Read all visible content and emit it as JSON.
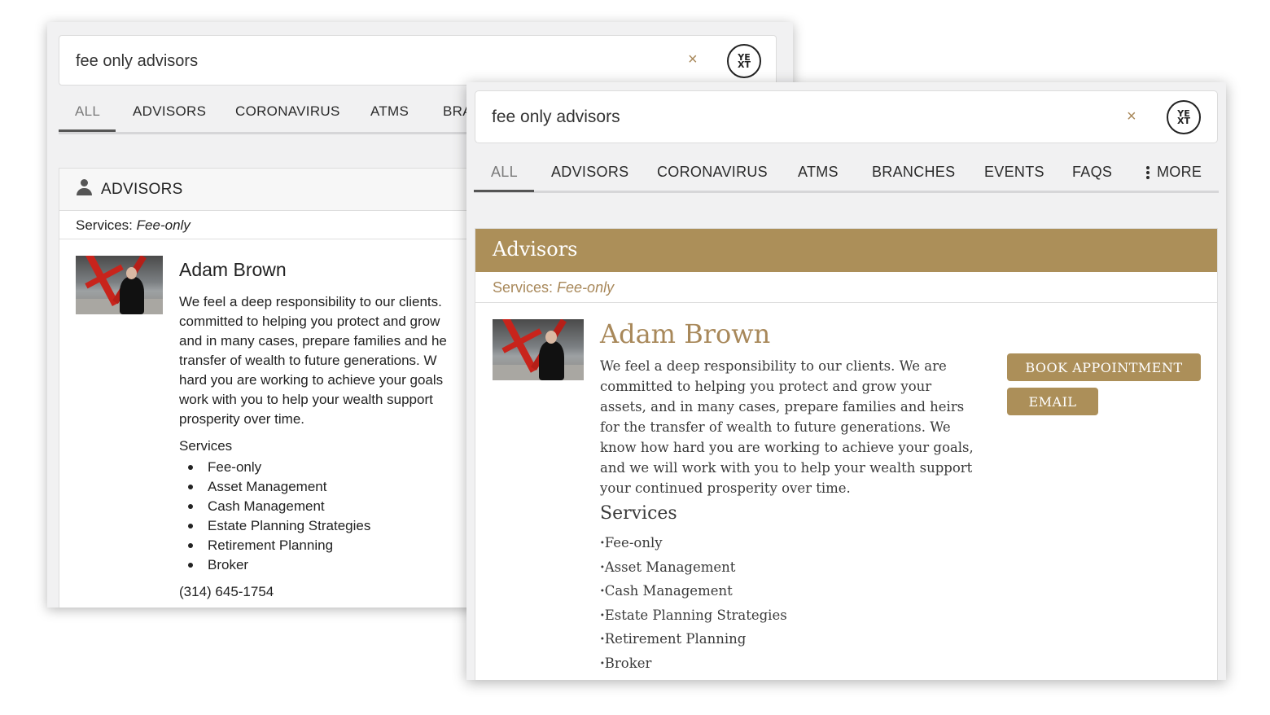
{
  "logo_text": [
    "YE",
    "XT"
  ],
  "back_card": {
    "search": {
      "query": "fee only advisors",
      "clear": "×"
    },
    "tabs": [
      "ALL",
      "ADVISORS",
      "CORONAVIRUS",
      "ATMS",
      "BRA"
    ],
    "section": {
      "title": "ADVISORS",
      "filter_label": "Services:",
      "filter_value": "Fee-only"
    },
    "result": {
      "name": "Adam Brown",
      "desc_lines": [
        "We feel a deep responsibility to our clients.",
        "committed to helping you protect and grow",
        "and in many cases, prepare families and he",
        "transfer of wealth to future generations. W",
        "hard you are working to achieve your goals",
        "work with you to help your wealth support",
        "prosperity over time."
      ],
      "services_title": "Services",
      "services": [
        "Fee-only",
        "Asset Management",
        "Cash Management",
        "Estate Planning Strategies",
        "Retirement Planning",
        "Broker"
      ],
      "phone": "(314) 645-1754"
    }
  },
  "front_card": {
    "search": {
      "query": "fee only advisors",
      "clear": "×"
    },
    "tabs": [
      "ALL",
      "ADVISORS",
      "CORONAVIRUS",
      "ATMS",
      "BRANCHES",
      "EVENTS",
      "FAQS",
      "MORE"
    ],
    "section": {
      "title": "Advisors",
      "filter_label": "Services:",
      "filter_value": "Fee-only"
    },
    "result": {
      "name": "Adam Brown",
      "desc_lines": [
        "We feel a deep responsibility to our clients. We are",
        "committed to helping you protect and grow your",
        "assets, and in many cases, prepare families and heirs",
        "for the transfer of wealth to future generations. We",
        "know how hard you are working to achieve your goals,",
        "and we will work with you to help your wealth support",
        "your continued prosperity over time."
      ],
      "services_title": "Services",
      "services": [
        "Fee-only",
        "Asset Management",
        "Cash Management",
        "Estate Planning Strategies",
        "Retirement Planning",
        "Broker"
      ],
      "book_label": "BOOK APPOINTMENT",
      "email_label": "EMAIL"
    }
  },
  "colors": {
    "accent_gold": "#ac8f59",
    "accent_text": "#a8885a",
    "page_bg": "#f1f1f2"
  },
  "icons": [
    "yext-logo-icon",
    "clear-icon",
    "person-icon",
    "more-dots-icon"
  ]
}
